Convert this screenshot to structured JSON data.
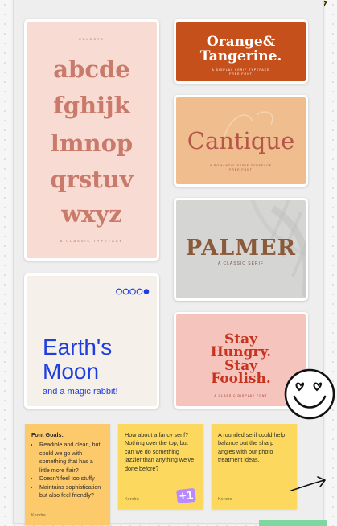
{
  "cards": {
    "alphabet": {
      "caption_top": "CELESTE",
      "lines": [
        "abcde",
        "fghijk",
        "lmnop",
        "qrstuv",
        "wxyz"
      ],
      "caption_bottom": "A CLASSIC TYPEFACE"
    },
    "orange": {
      "title_line1": "Orange&",
      "title_line2": "Tangerine.",
      "subtitle_line1": "A DISPLAY SERIF TYPEFACE",
      "subtitle_line2": "FREE FONT"
    },
    "cantique": {
      "title": "Cantique",
      "subtitle_line1": "A ROMANTIC SERIF TYPEFACE",
      "subtitle_line2": "FREE FONT"
    },
    "palmer": {
      "title": "PALMER",
      "subtitle": "A CLASSIC SERIF"
    },
    "earth": {
      "line1": "Earth's",
      "line2": "Moon",
      "subtitle": "and a magic rabbit!"
    },
    "stay": {
      "line1": "Stay",
      "line2": "Hungry.",
      "line3": "Stay",
      "line4": "Foolish.",
      "caption": "A CLASSIC DISPLAY FONT"
    }
  },
  "notes": {
    "goals": {
      "title": "Font Goals:",
      "bullets": [
        "Readible and clean, but could we go with something that has a little more flair?",
        "Doesn't feel too stuffy",
        "Maintains sophistication but also feel friendly?"
      ],
      "author": "Kendra"
    },
    "fancy": {
      "text": "How about a fancy serif? Nothing over the top, but can we do something jazzier than anything we've done before?",
      "author": "Kendra",
      "badge": "+1"
    },
    "rounded": {
      "text": "A rounded serif could help balance out the sharp angles with our photo treatment ideas.",
      "author": "Kendra"
    }
  },
  "colors": {
    "note_yellow": "#fcd85e",
    "note_orange": "#fcc96b",
    "badge_purple": "#b889ff",
    "earth_blue": "#1f3ee0"
  }
}
